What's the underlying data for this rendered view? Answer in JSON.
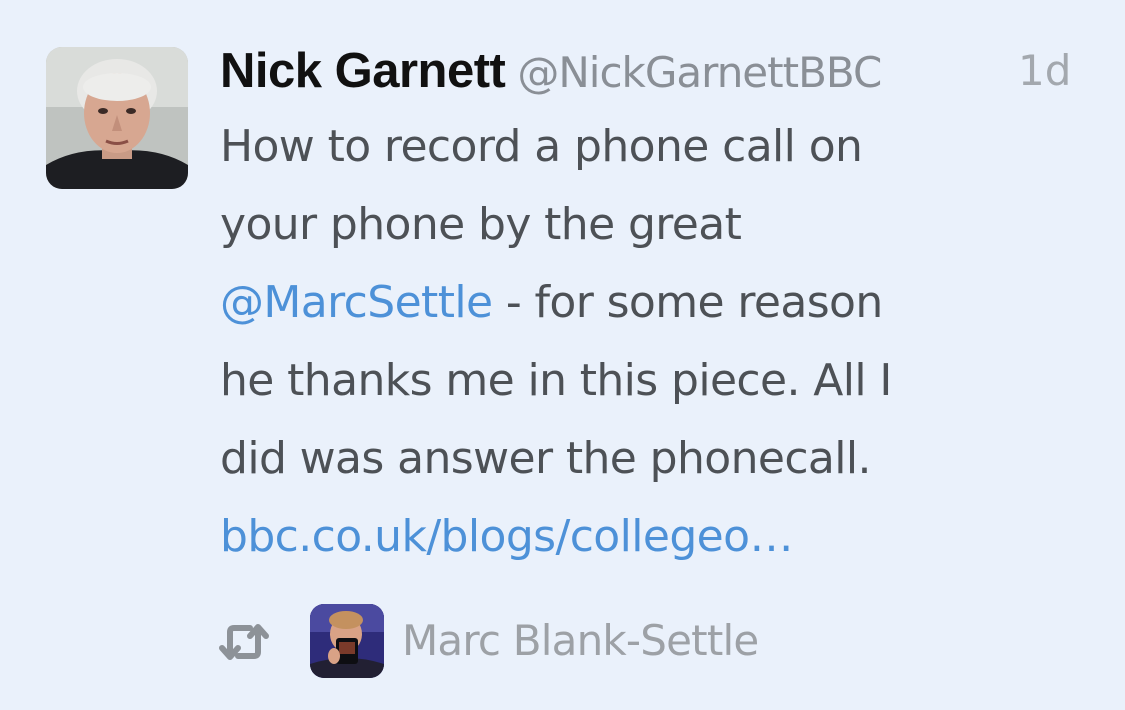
{
  "tweet": {
    "author_name": "Nick Garnett",
    "author_handle": "@NickGarnettBBC",
    "timestamp": "1d",
    "text_lines": {
      "l1": "How to record a phone call on",
      "l2": "your phone by the great",
      "l3_mention": "@MarcSettle",
      "l3_rest": " - for some reason",
      "l4": "he thanks me in this piece. All I",
      "l5": "did was answer the phonecall.",
      "l6_link": "bbc.co.uk/blogs/collegeo…"
    },
    "retweeted_by": "Marc Blank-Settle"
  },
  "icons": {
    "retweet": "retweet-icon"
  },
  "colors": {
    "background": "#eaf1fb",
    "link": "#4d91d8",
    "name": "#111111",
    "body_text": "#4d5156",
    "meta": "#8a8f96"
  }
}
